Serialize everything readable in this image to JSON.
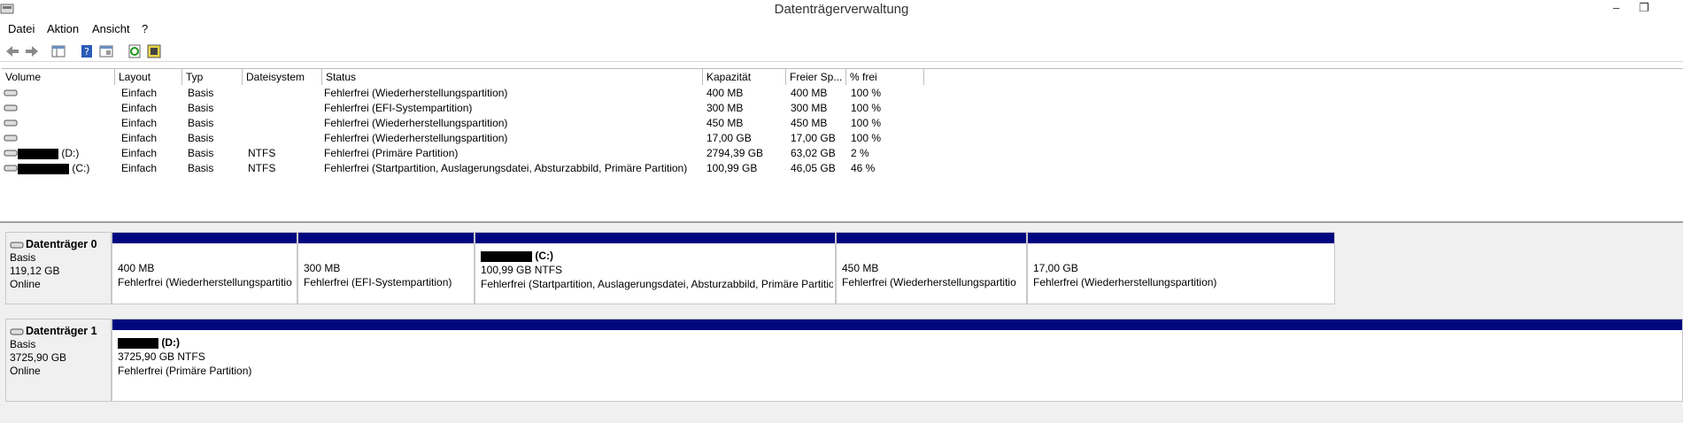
{
  "window": {
    "title": "Datenträgerverwaltung",
    "min": "–",
    "max": "❐"
  },
  "menu": [
    "Datei",
    "Aktion",
    "Ansicht",
    "?"
  ],
  "toolbar": {
    "icons": [
      "back-icon",
      "forward-icon",
      "list-view-icon",
      "help-icon",
      "properties-icon",
      "refresh-icon",
      "settings-icon"
    ]
  },
  "list": {
    "columns": [
      "Volume",
      "Layout",
      "Typ",
      "Dateisystem",
      "Status",
      "Kapazität",
      "Freier Sp...",
      "% frei"
    ],
    "rows": [
      {
        "volume": "",
        "layout": "Einfach",
        "typ": "Basis",
        "fs": "",
        "status": "Fehlerfrei (Wiederherstellungspartition)",
        "kap": "400 MB",
        "frei": "400 MB",
        "pct": "100 %"
      },
      {
        "volume": "",
        "layout": "Einfach",
        "typ": "Basis",
        "fs": "",
        "status": "Fehlerfrei (EFI-Systempartition)",
        "kap": "300 MB",
        "frei": "300 MB",
        "pct": "100 %"
      },
      {
        "volume": "",
        "layout": "Einfach",
        "typ": "Basis",
        "fs": "",
        "status": "Fehlerfrei (Wiederherstellungspartition)",
        "kap": "450 MB",
        "frei": "450 MB",
        "pct": "100 %"
      },
      {
        "volume": "",
        "layout": "Einfach",
        "typ": "Basis",
        "fs": "",
        "status": "Fehlerfrei (Wiederherstellungspartition)",
        "kap": "17,00 GB",
        "frei": "17,00 GB",
        "pct": "100 %"
      },
      {
        "volume": "(D:)",
        "layout": "Einfach",
        "typ": "Basis",
        "fs": "NTFS",
        "status": "Fehlerfrei (Primäre Partition)",
        "kap": "2794,39 GB",
        "frei": "63,02 GB",
        "pct": "2 %"
      },
      {
        "volume": "(C:)",
        "layout": "Einfach",
        "typ": "Basis",
        "fs": "NTFS",
        "status": "Fehlerfrei (Startpartition, Auslagerungsdatei, Absturzabbild, Primäre Partition)",
        "kap": "100,99 GB",
        "frei": "46,05 GB",
        "pct": "46 %"
      }
    ]
  },
  "disks": [
    {
      "name": "Datenträger 0",
      "type": "Basis",
      "size": "119,12 GB",
      "state": "Online",
      "partitions": [
        {
          "label": "",
          "size": "400 MB",
          "status": "Fehlerfrei (Wiederherstellungspartitio"
        },
        {
          "label": "",
          "size": "300 MB",
          "status": "Fehlerfrei (EFI-Systempartition)"
        },
        {
          "label": "(C:)",
          "size": "100,99 GB NTFS",
          "status": "Fehlerfrei (Startpartition, Auslagerungsdatei, Absturzabbild, Primäre Partitio"
        },
        {
          "label": "",
          "size": "450 MB",
          "status": "Fehlerfrei (Wiederherstellungspartitio"
        },
        {
          "label": "",
          "size": "17,00 GB",
          "status": "Fehlerfrei (Wiederherstellungspartition)"
        }
      ]
    },
    {
      "name": "Datenträger 1",
      "type": "Basis",
      "size": "3725,90 GB",
      "state": "Online",
      "partitions": [
        {
          "label": "(D:)",
          "size": "3725,90 GB NTFS",
          "status": "Fehlerfrei (Primäre Partition)"
        }
      ]
    }
  ],
  "colors": {
    "partition_bar": "#00087f",
    "background": "#f0f0f0"
  }
}
